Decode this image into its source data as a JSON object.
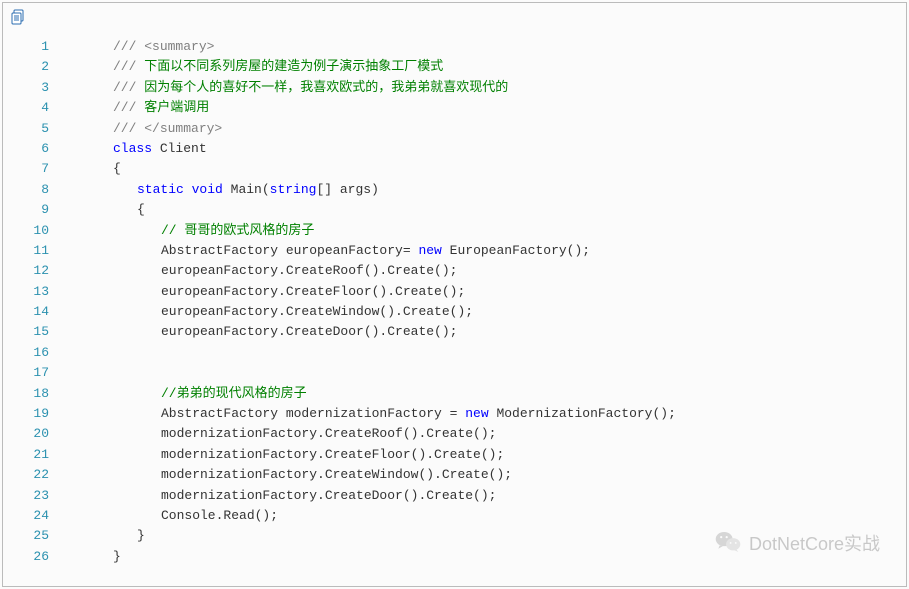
{
  "watermark": "DotNetCore实战",
  "code": {
    "lines": [
      {
        "n": "1",
        "ind": "ind1",
        "seg": [
          {
            "c": "t-gray",
            "t": "/// "
          },
          {
            "c": "t-gray",
            "t": "<summary>"
          }
        ]
      },
      {
        "n": "2",
        "ind": "ind1",
        "seg": [
          {
            "c": "t-gray",
            "t": "///"
          },
          {
            "c": "t-green",
            "t": " 下面以不同系列房屋的建造为例子演示抽象工厂模式"
          }
        ]
      },
      {
        "n": "3",
        "ind": "ind1",
        "seg": [
          {
            "c": "t-gray",
            "t": "///"
          },
          {
            "c": "t-green",
            "t": " 因为每个人的喜好不一样，我喜欢欧式的，我弟弟就喜欢现代的"
          }
        ]
      },
      {
        "n": "4",
        "ind": "ind1",
        "seg": [
          {
            "c": "t-gray",
            "t": "///"
          },
          {
            "c": "t-green",
            "t": " 客户端调用"
          }
        ]
      },
      {
        "n": "5",
        "ind": "ind1",
        "seg": [
          {
            "c": "t-gray",
            "t": "/// "
          },
          {
            "c": "t-gray",
            "t": "</summary>"
          }
        ]
      },
      {
        "n": "6",
        "ind": "ind1",
        "seg": [
          {
            "c": "t-blue",
            "t": "class"
          },
          {
            "c": "",
            "t": " Client"
          }
        ]
      },
      {
        "n": "7",
        "ind": "ind1",
        "seg": [
          {
            "c": "",
            "t": "{"
          }
        ]
      },
      {
        "n": "8",
        "ind": "ind2",
        "seg": [
          {
            "c": "t-blue",
            "t": "static"
          },
          {
            "c": "",
            "t": " "
          },
          {
            "c": "t-blue",
            "t": "void"
          },
          {
            "c": "",
            "t": " Main("
          },
          {
            "c": "t-blue",
            "t": "string"
          },
          {
            "c": "",
            "t": "[] args)"
          }
        ]
      },
      {
        "n": "9",
        "ind": "ind2",
        "seg": [
          {
            "c": "",
            "t": "{"
          }
        ]
      },
      {
        "n": "10",
        "ind": "ind3",
        "seg": [
          {
            "c": "t-green",
            "t": "// 哥哥的欧式风格的房子"
          }
        ]
      },
      {
        "n": "11",
        "ind": "ind3",
        "seg": [
          {
            "c": "",
            "t": "AbstractFactory europeanFactory= "
          },
          {
            "c": "t-blue",
            "t": "new"
          },
          {
            "c": "",
            "t": " EuropeanFactory();"
          }
        ]
      },
      {
        "n": "12",
        "ind": "ind3",
        "seg": [
          {
            "c": "",
            "t": "europeanFactory.CreateRoof().Create();"
          }
        ]
      },
      {
        "n": "13",
        "ind": "ind3",
        "seg": [
          {
            "c": "",
            "t": "europeanFactory.CreateFloor().Create();"
          }
        ]
      },
      {
        "n": "14",
        "ind": "ind3",
        "seg": [
          {
            "c": "",
            "t": "europeanFactory.CreateWindow().Create();"
          }
        ]
      },
      {
        "n": "15",
        "ind": "ind3",
        "seg": [
          {
            "c": "",
            "t": "europeanFactory.CreateDoor().Create();"
          }
        ]
      },
      {
        "n": "16",
        "ind": "ind3",
        "seg": [
          {
            "c": "",
            "t": ""
          }
        ]
      },
      {
        "n": "17",
        "ind": "ind3",
        "seg": [
          {
            "c": "",
            "t": ""
          }
        ]
      },
      {
        "n": "18",
        "ind": "ind3",
        "seg": [
          {
            "c": "t-green",
            "t": "//弟弟的现代风格的房子"
          }
        ]
      },
      {
        "n": "19",
        "ind": "ind3",
        "seg": [
          {
            "c": "",
            "t": "AbstractFactory modernizationFactory = "
          },
          {
            "c": "t-blue",
            "t": "new"
          },
          {
            "c": "",
            "t": " ModernizationFactory();"
          }
        ]
      },
      {
        "n": "20",
        "ind": "ind3",
        "seg": [
          {
            "c": "",
            "t": "modernizationFactory.CreateRoof().Create();"
          }
        ]
      },
      {
        "n": "21",
        "ind": "ind3",
        "seg": [
          {
            "c": "",
            "t": "modernizationFactory.CreateFloor().Create();"
          }
        ]
      },
      {
        "n": "22",
        "ind": "ind3",
        "seg": [
          {
            "c": "",
            "t": "modernizationFactory.CreateWindow().Create();"
          }
        ]
      },
      {
        "n": "23",
        "ind": "ind3",
        "seg": [
          {
            "c": "",
            "t": "modernizationFactory.CreateDoor().Create();"
          }
        ]
      },
      {
        "n": "24",
        "ind": "ind3",
        "seg": [
          {
            "c": "",
            "t": "Console.Read();"
          }
        ]
      },
      {
        "n": "25",
        "ind": "ind2",
        "seg": [
          {
            "c": "",
            "t": "}"
          }
        ]
      },
      {
        "n": "26",
        "ind": "ind1",
        "seg": [
          {
            "c": "",
            "t": "}"
          }
        ]
      }
    ]
  }
}
